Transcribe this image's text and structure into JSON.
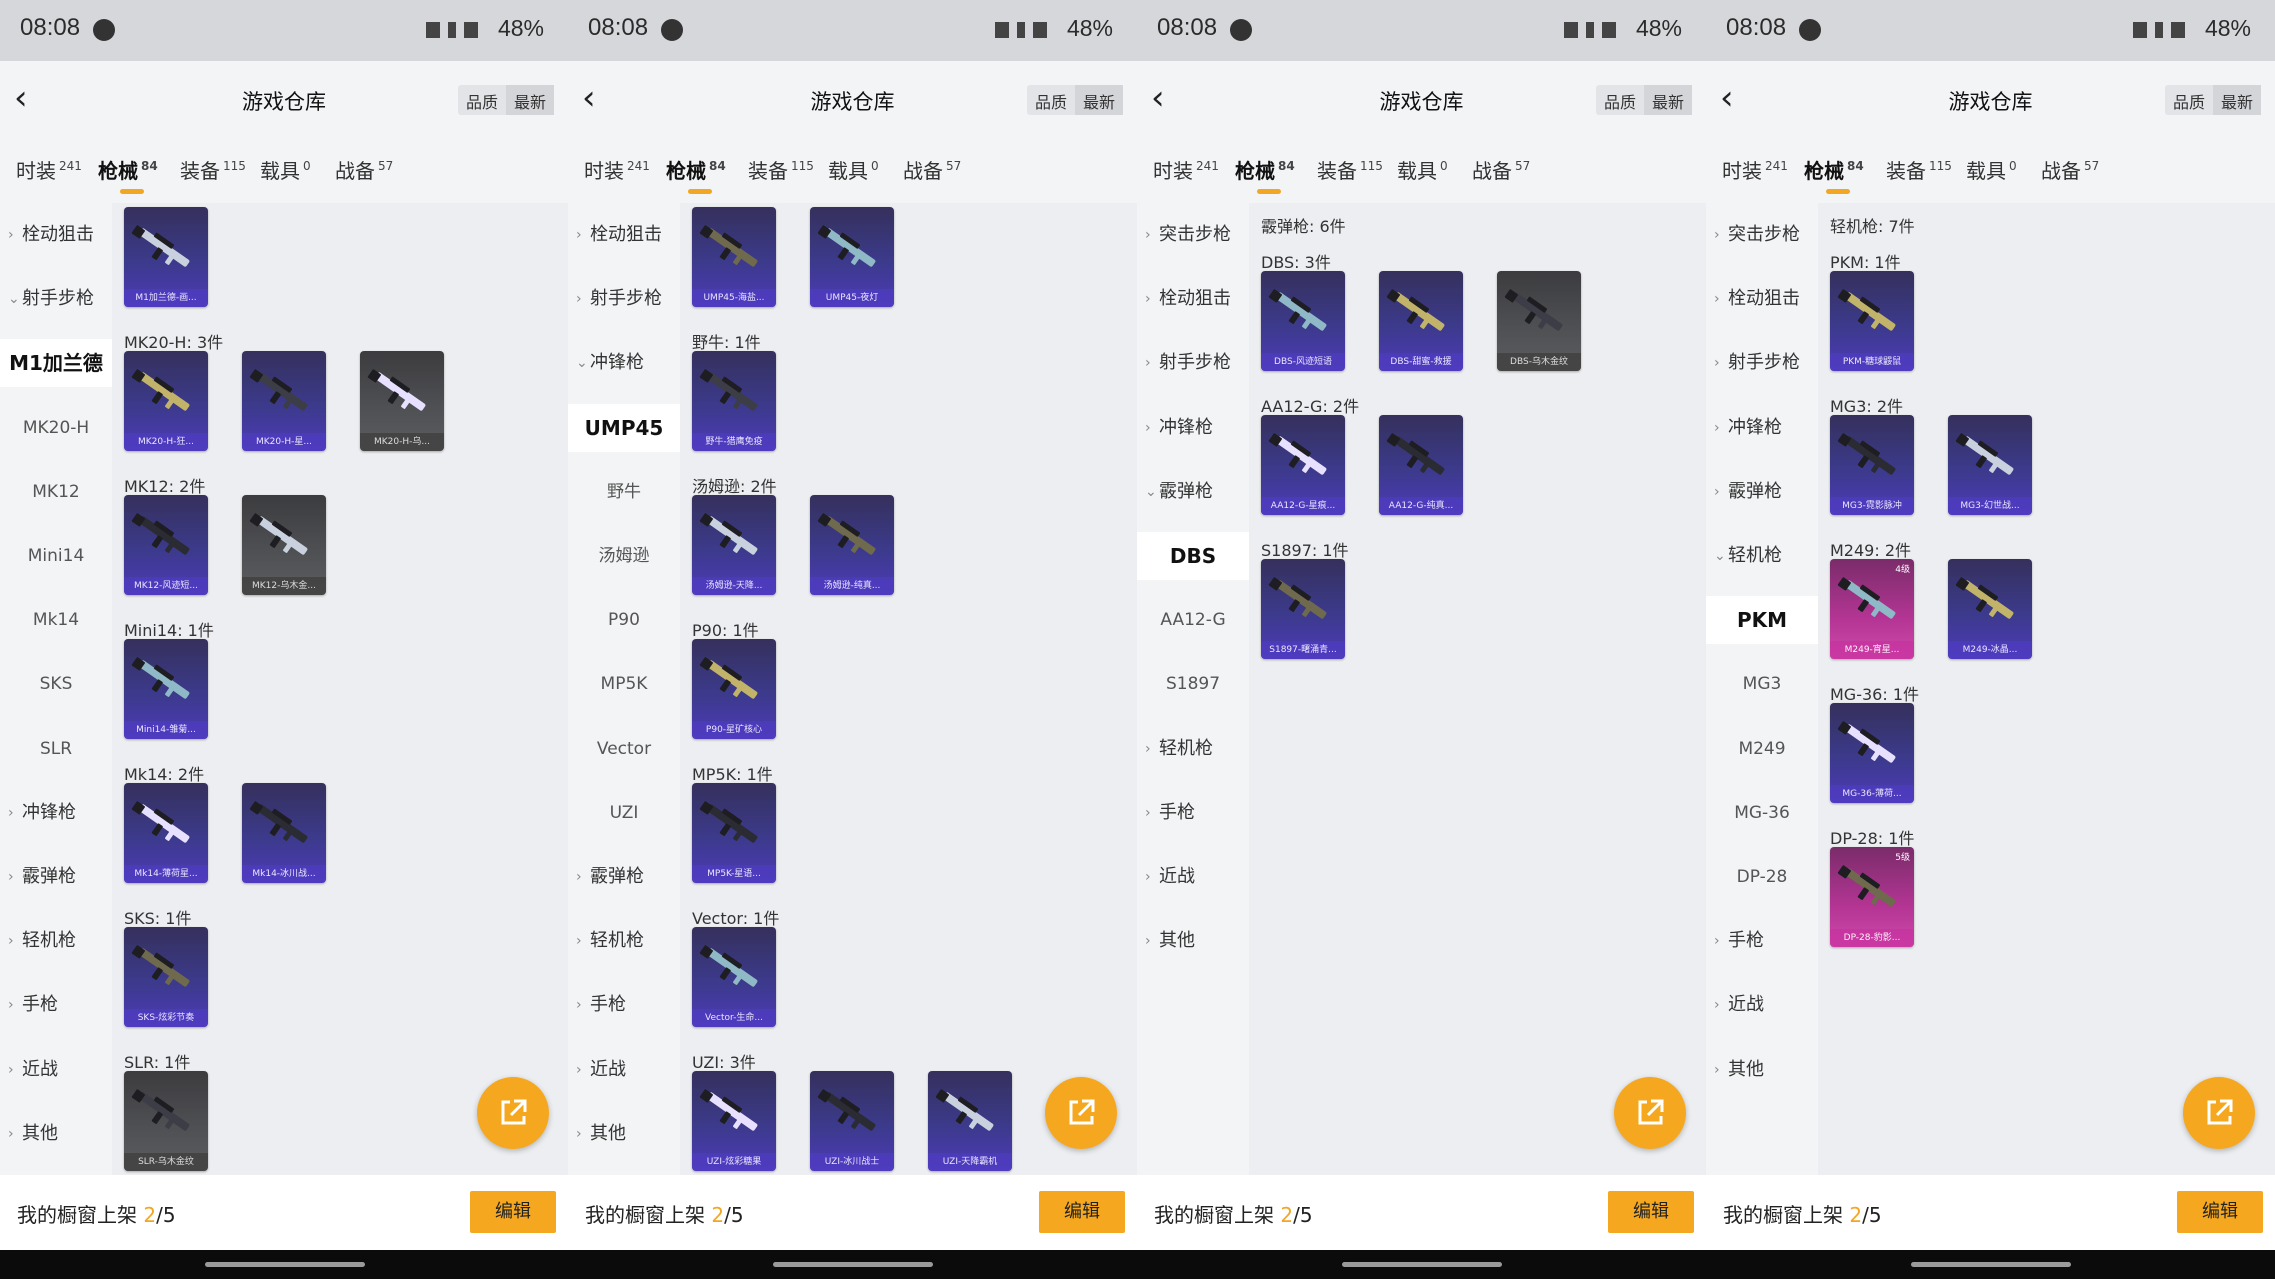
{
  "colors": {
    "accent": "#f3a623",
    "card_purple": "#4d3bb6",
    "card_grey": "#505154",
    "card_pink": "#cf49a9"
  },
  "statusbar": {
    "time": "08:08",
    "battery": "48%"
  },
  "navbar": {
    "back_icon": "chevron-left-icon",
    "title": "游戏仓库",
    "sort_quality": "品质",
    "sort_newest": "最新"
  },
  "tabs": [
    {
      "label": "时装",
      "count": "241"
    },
    {
      "label": "枪械",
      "count": "84"
    },
    {
      "label": "装备",
      "count": "115"
    },
    {
      "label": "载具",
      "count": "0"
    },
    {
      "label": "战备",
      "count": "57"
    }
  ],
  "bottom": {
    "prefix": "我的橱窗上架 ",
    "current": "2",
    "total": "/5",
    "edit_label": "编辑"
  },
  "share_icon": "share-external-icon",
  "screens": [
    {
      "sidebar": [
        {
          "label": "栓动狙击",
          "kind": "parent",
          "state": "collapsed"
        },
        {
          "label": "射手步枪",
          "kind": "parent",
          "state": "expanded"
        },
        {
          "label": "M1加兰德",
          "kind": "selected"
        },
        {
          "label": "MK20-H",
          "kind": "child"
        },
        {
          "label": "MK12",
          "kind": "child"
        },
        {
          "label": "Mini14",
          "kind": "child"
        },
        {
          "label": "Mk14",
          "kind": "child"
        },
        {
          "label": "SKS",
          "kind": "child"
        },
        {
          "label": "SLR",
          "kind": "child"
        },
        {
          "label": "冲锋枪",
          "kind": "parent",
          "state": "collapsed"
        },
        {
          "label": "霰弹枪",
          "kind": "parent",
          "state": "collapsed"
        },
        {
          "label": "轻机枪",
          "kind": "parent",
          "state": "collapsed"
        },
        {
          "label": "手枪",
          "kind": "parent",
          "state": "collapsed"
        },
        {
          "label": "近战",
          "kind": "parent",
          "state": "collapsed"
        },
        {
          "label": "其他",
          "kind": "parent",
          "state": "collapsed"
        }
      ],
      "sections": [
        {
          "label": "",
          "items": [
            {
              "name": "M1加兰德-画...",
              "tier": "purple"
            }
          ]
        },
        {
          "label": "MK20-H: 3件",
          "items": [
            {
              "name": "MK20-H-狂...",
              "tier": "purple"
            },
            {
              "name": "MK20-H-星...",
              "tier": "purple"
            },
            {
              "name": "MK20-H-乌...",
              "tier": "grey"
            }
          ]
        },
        {
          "label": "MK12: 2件",
          "items": [
            {
              "name": "MK12-风迹短...",
              "tier": "purple"
            },
            {
              "name": "MK12-乌木金...",
              "tier": "grey"
            }
          ]
        },
        {
          "label": "Mini14: 1件",
          "items": [
            {
              "name": "Mini14-雏菊...",
              "tier": "purple"
            }
          ]
        },
        {
          "label": "Mk14: 2件",
          "items": [
            {
              "name": "Mk14-薄荷星...",
              "tier": "purple"
            },
            {
              "name": "Mk14-冰川战...",
              "tier": "purple"
            }
          ]
        },
        {
          "label": "SKS: 1件",
          "items": [
            {
              "name": "SKS-炫彩节奏",
              "tier": "purple"
            }
          ]
        },
        {
          "label": "SLR: 1件",
          "items": [
            {
              "name": "SLR-乌木金纹",
              "tier": "grey"
            }
          ]
        }
      ]
    },
    {
      "sidebar": [
        {
          "label": "栓动狙击",
          "kind": "parent",
          "state": "collapsed"
        },
        {
          "label": "射手步枪",
          "kind": "parent",
          "state": "collapsed"
        },
        {
          "label": "冲锋枪",
          "kind": "parent",
          "state": "expanded"
        },
        {
          "label": "UMP45",
          "kind": "selected"
        },
        {
          "label": "野牛",
          "kind": "child"
        },
        {
          "label": "汤姆逊",
          "kind": "child"
        },
        {
          "label": "P90",
          "kind": "child"
        },
        {
          "label": "MP5K",
          "kind": "child"
        },
        {
          "label": "Vector",
          "kind": "child"
        },
        {
          "label": "UZI",
          "kind": "child"
        },
        {
          "label": "霰弹枪",
          "kind": "parent",
          "state": "collapsed"
        },
        {
          "label": "轻机枪",
          "kind": "parent",
          "state": "collapsed"
        },
        {
          "label": "手枪",
          "kind": "parent",
          "state": "collapsed"
        },
        {
          "label": "近战",
          "kind": "parent",
          "state": "collapsed"
        },
        {
          "label": "其他",
          "kind": "parent",
          "state": "collapsed"
        }
      ],
      "sections": [
        {
          "label": "",
          "items": [
            {
              "name": "UMP45-海盐...",
              "tier": "purple"
            },
            {
              "name": "UMP45-夜灯",
              "tier": "purple"
            }
          ]
        },
        {
          "label": "野牛: 1件",
          "items": [
            {
              "name": "野牛-猎鹰免疫",
              "tier": "purple"
            }
          ]
        },
        {
          "label": "汤姆逊: 2件",
          "items": [
            {
              "name": "汤姆逊-天降...",
              "tier": "purple"
            },
            {
              "name": "汤姆逊-纯真...",
              "tier": "purple"
            }
          ]
        },
        {
          "label": "P90: 1件",
          "items": [
            {
              "name": "P90-星矿核心",
              "tier": "purple"
            }
          ]
        },
        {
          "label": "MP5K: 1件",
          "items": [
            {
              "name": "MP5K-星语...",
              "tier": "purple"
            }
          ]
        },
        {
          "label": "Vector: 1件",
          "items": [
            {
              "name": "Vector-生命...",
              "tier": "purple"
            }
          ]
        },
        {
          "label": "UZI: 3件",
          "items": [
            {
              "name": "UZI-炫彩糖果",
              "tier": "purple"
            },
            {
              "name": "UZI-冰川战士",
              "tier": "purple"
            },
            {
              "name": "UZI-天降霸机",
              "tier": "purple"
            }
          ]
        }
      ]
    },
    {
      "sidebar": [
        {
          "label": "突击步枪",
          "kind": "parent",
          "state": "collapsed"
        },
        {
          "label": "栓动狙击",
          "kind": "parent",
          "state": "collapsed"
        },
        {
          "label": "射手步枪",
          "kind": "parent",
          "state": "collapsed"
        },
        {
          "label": "冲锋枪",
          "kind": "parent",
          "state": "collapsed"
        },
        {
          "label": "霰弹枪",
          "kind": "parent",
          "state": "expanded"
        },
        {
          "label": "DBS",
          "kind": "selected"
        },
        {
          "label": "AA12-G",
          "kind": "child"
        },
        {
          "label": "S1897",
          "kind": "child"
        },
        {
          "label": "轻机枪",
          "kind": "parent",
          "state": "collapsed"
        },
        {
          "label": "手枪",
          "kind": "parent",
          "state": "collapsed"
        },
        {
          "label": "近战",
          "kind": "parent",
          "state": "collapsed"
        },
        {
          "label": "其他",
          "kind": "parent",
          "state": "collapsed"
        }
      ],
      "header": "霰弹枪: 6件",
      "sections": [
        {
          "label": "DBS: 3件",
          "items": [
            {
              "name": "DBS-风迹短语",
              "tier": "purple"
            },
            {
              "name": "DBS-甜蜜-救援",
              "tier": "purple"
            },
            {
              "name": "DBS-乌木金纹",
              "tier": "grey"
            }
          ]
        },
        {
          "label": "AA12-G: 2件",
          "items": [
            {
              "name": "AA12-G-星痕...",
              "tier": "purple"
            },
            {
              "name": "AA12-G-纯真...",
              "tier": "purple"
            }
          ]
        },
        {
          "label": "S1897: 1件",
          "items": [
            {
              "name": "S1897-曙涌青...",
              "tier": "purple"
            }
          ]
        }
      ]
    },
    {
      "sidebar": [
        {
          "label": "突击步枪",
          "kind": "parent",
          "state": "collapsed"
        },
        {
          "label": "栓动狙击",
          "kind": "parent",
          "state": "collapsed"
        },
        {
          "label": "射手步枪",
          "kind": "parent",
          "state": "collapsed"
        },
        {
          "label": "冲锋枪",
          "kind": "parent",
          "state": "collapsed"
        },
        {
          "label": "霰弹枪",
          "kind": "parent",
          "state": "collapsed"
        },
        {
          "label": "轻机枪",
          "kind": "parent",
          "state": "expanded"
        },
        {
          "label": "PKM",
          "kind": "selected"
        },
        {
          "label": "MG3",
          "kind": "child"
        },
        {
          "label": "M249",
          "kind": "child"
        },
        {
          "label": "MG-36",
          "kind": "child"
        },
        {
          "label": "DP-28",
          "kind": "child"
        },
        {
          "label": "手枪",
          "kind": "parent",
          "state": "collapsed"
        },
        {
          "label": "近战",
          "kind": "parent",
          "state": "collapsed"
        },
        {
          "label": "其他",
          "kind": "parent",
          "state": "collapsed"
        }
      ],
      "header": "轻机枪: 7件",
      "sections": [
        {
          "label": "PKM: 1件",
          "items": [
            {
              "name": "PKM-糖球鼹鼠",
              "tier": "purple"
            }
          ]
        },
        {
          "label": "MG3: 2件",
          "items": [
            {
              "name": "MG3-霓影脉冲",
              "tier": "purple"
            },
            {
              "name": "MG3-幻世战...",
              "tier": "purple"
            }
          ]
        },
        {
          "label": "M249: 2件",
          "items": [
            {
              "name": "M249-宵星...",
              "tier": "pink",
              "level": "4级"
            },
            {
              "name": "M249-冰晶...",
              "tier": "purple"
            }
          ]
        },
        {
          "label": "MG-36: 1件",
          "items": [
            {
              "name": "MG-36-薄荷...",
              "tier": "purple"
            }
          ]
        },
        {
          "label": "DP-28: 1件",
          "items": [
            {
              "name": "DP-28-豹影...",
              "tier": "pink",
              "level": "5级"
            }
          ]
        }
      ]
    }
  ]
}
